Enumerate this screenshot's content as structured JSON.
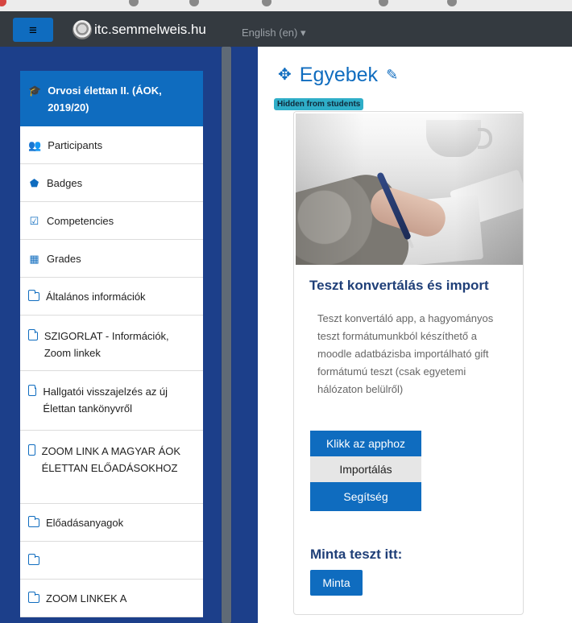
{
  "header": {
    "site_name": "itc.semmelweis.hu",
    "language": "English (en) ▾",
    "menu_icon": "hamburger-icon",
    "logo": "university-seal"
  },
  "sidebar": {
    "items": [
      {
        "label": "Orvosi élettan II. (ÁOK, 2019/20)",
        "icon": "graduation-cap-icon",
        "active": true
      },
      {
        "label": "Participants",
        "icon": "users-icon"
      },
      {
        "label": "Badges",
        "icon": "shield-icon"
      },
      {
        "label": "Competencies",
        "icon": "checkbox-icon"
      },
      {
        "label": "Grades",
        "icon": "table-icon"
      },
      {
        "label": "Általános információk",
        "icon": "folder-icon"
      },
      {
        "label": "SZIGORLAT - Információk, Zoom linkek",
        "icon": "folder-icon"
      },
      {
        "label": "Hallgatói visszajelzés az új Élettan tankönyvről",
        "icon": "folder-icon"
      },
      {
        "label": "ZOOM LINK A MAGYAR ÁOK ÉLETTAN ELŐADÁSOKHOZ",
        "icon": "folder-icon"
      },
      {
        "label": "Előadásanyagok",
        "icon": "folder-icon"
      },
      {
        "label": "",
        "icon": "folder-icon"
      },
      {
        "label": "ZOOM LINKEK A",
        "icon": "folder-icon"
      }
    ]
  },
  "main": {
    "section_title": "Egyebek",
    "hidden_badge": "Hidden from students",
    "card": {
      "title": "Teszt konvertálás és import",
      "description": "Teszt konvertáló app, a hagyományos teszt formátumunkból készíthető a moodle adatbázisba importálható gift formátumú teszt (csak egyetemi hálózaton belülről)",
      "buttons": {
        "app": "Klikk az apphoz",
        "import": "Importálás",
        "help": "Segítség"
      },
      "sample_title": "Minta teszt itt:",
      "sample_button": "Minta"
    }
  },
  "colors": {
    "primary": "#0f6cbf",
    "navbar": "#343a40",
    "sidebar_bg": "#1c3f8a",
    "badge": "#2faec8"
  }
}
